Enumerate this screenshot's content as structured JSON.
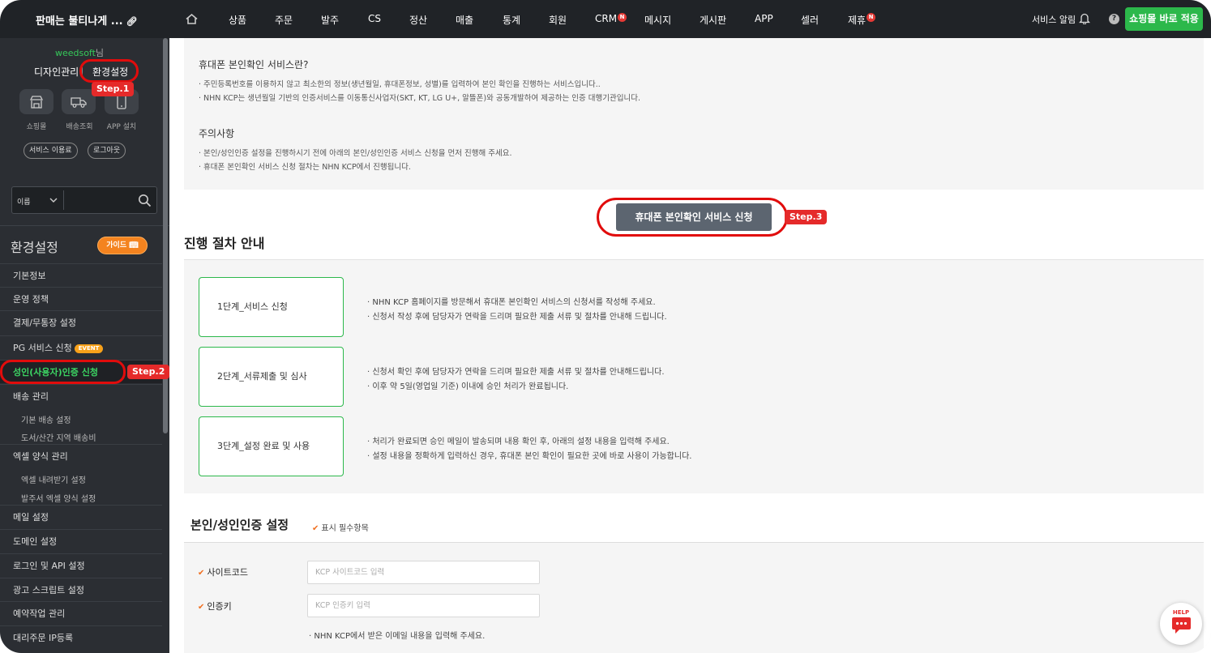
{
  "topbar": {
    "brand": "판매는 불티나게 ...",
    "nav": [
      {
        "label": "상품",
        "badge": ""
      },
      {
        "label": "주문",
        "badge": ""
      },
      {
        "label": "발주",
        "badge": ""
      },
      {
        "label": "CS",
        "badge": ""
      },
      {
        "label": "정산",
        "badge": ""
      },
      {
        "label": "매출",
        "badge": ""
      },
      {
        "label": "통계",
        "badge": ""
      },
      {
        "label": "회원",
        "badge": ""
      },
      {
        "label": "CRM",
        "badge": "N"
      },
      {
        "label": "메시지",
        "badge": ""
      },
      {
        "label": "게시판",
        "badge": ""
      },
      {
        "label": "APP",
        "badge": ""
      },
      {
        "label": "셀러",
        "badge": ""
      },
      {
        "label": "제휴",
        "badge": "N"
      }
    ],
    "service_alert": "서비스 알림",
    "help_mark": "?",
    "apply_button": "쇼핑몰 바로 적용"
  },
  "sidebar": {
    "username": "weedsoft",
    "username_suffix": "님",
    "design_mgmt": "디자인관리",
    "env_settings": "환경설정",
    "quick": [
      {
        "label": "쇼핑몰",
        "icon": "store-icon"
      },
      {
        "label": "배송조회",
        "icon": "truck-icon"
      },
      {
        "label": "APP 설치",
        "icon": "phone-icon"
      }
    ],
    "pills": [
      "서비스 이용료",
      "로그아웃"
    ],
    "search_select": "이름",
    "section_title": "환경설정",
    "guide_button": "가이드",
    "items": [
      {
        "label": "기본정보"
      },
      {
        "label": "운영 정책"
      },
      {
        "label": "결제/무통장 설정"
      },
      {
        "label": "PG 서비스 신청",
        "event": "EVENT"
      },
      {
        "label": "성인(사용자)인증 신청"
      },
      {
        "label": "배송 관리"
      },
      {
        "label": "엑셀 양식 관리"
      },
      {
        "label": "메일 설정"
      },
      {
        "label": "도메인 설정"
      },
      {
        "label": "로그인 및 API 설정"
      },
      {
        "label": "광고 스크립트 설정"
      },
      {
        "label": "예약작업 관리"
      },
      {
        "label": "대리주문 IP등록"
      }
    ],
    "sub_items": {
      "shipping": [
        "기본 배송 설정",
        "도서/산간 지역 배송비"
      ],
      "excel": [
        "엑셀 내려받기 설정",
        "발주서 엑셀 양식 설정"
      ]
    }
  },
  "steps": {
    "step1": "Step.1",
    "step2": "Step.2",
    "step3": "Step.3"
  },
  "info": {
    "what_title": "휴대폰 본인확인 서비스란?",
    "what_lines": [
      "· 주민등록번호를 이용하지 않고 최소한의 정보(생년월일, 휴대폰정보, 성별)를 입력하여 본인 확인을 진행하는 서비스입니다..",
      "· NHN KCP는 생년월일 기반의 인증서비스를 이동통신사업자(SKT, KT, LG U+, 알뜰폰)와 공동개발하여 제공하는 인증 대행기관입니다."
    ],
    "caution_title": "주의사항",
    "caution_lines": [
      "· 본인/성인인증 설정을 진행하시기 전에 아래의 본인/성인인증 서비스 신청을 먼저 진행해 주세요.",
      "· 휴대폰 본인확인 서비스 신청 절차는 NHN KCP에서 진행됩니다."
    ]
  },
  "apply_service_button": "휴대폰 본인확인 서비스 신청",
  "process": {
    "title": "진행 절차 안내",
    "steps": [
      {
        "label": "1단계_서비스 신청",
        "lines": [
          "· NHN KCP 홈페이지를 방문해서 휴대폰 본인확인 서비스의 신청서를 작성해 주세요.",
          "· 신청서 작성 후에 담당자가 연락을 드리며 필요한 제출 서류 및 절차를 안내해 드립니다."
        ]
      },
      {
        "label": "2단계_서류제출 및 심사",
        "lines": [
          "· 신청서 확인 후에 담당자가 연락을 드리며 필요한 제출 서류 및 절차를 안내해드립니다.",
          "· 이후 약 5일(영업일 기준) 이내에 승인 처리가 완료됩니다."
        ]
      },
      {
        "label": "3단계_설정 완료 및 사용",
        "lines": [
          "· 처리가 완료되면 승인 메일이 발송되며 내용 확인 후, 아래의 설정 내용을 입력해 주세요.",
          "· 설정 내용을 정확하게 입력하신 경우, 휴대폰 본인 확인이 필요한 곳에 바로 사용이 가능합니다."
        ]
      }
    ]
  },
  "auth": {
    "title": "본인/성인인증 설정",
    "required_note": "표시 필수항목",
    "site_code_label": "사이트코드",
    "site_code_placeholder": "KCP 사이트코드 입력",
    "auth_key_label": "인증키",
    "auth_key_placeholder": "KCP 인증키 입력",
    "note": "· NHN KCP에서 받은 이메일 내용을 입력해 주세요."
  },
  "help_fab": "HELP",
  "colors": {
    "accent_green": "#2cb84b",
    "step_red": "#e52a2a",
    "guide_orange": "#f4831f",
    "topbar": "#202327",
    "sidebar": "#2b2e33"
  }
}
